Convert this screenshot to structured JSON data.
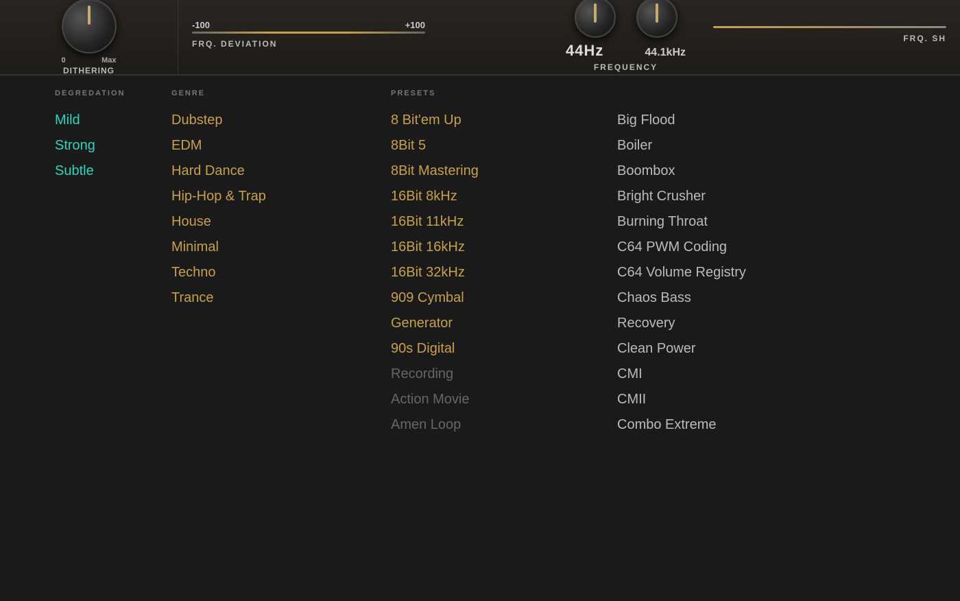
{
  "topPanel": {
    "dithering": {
      "knob": {
        "min": "0",
        "max": "Max",
        "label": "DITHERING"
      }
    },
    "frqDeviation": {
      "range_min": "-100",
      "range_max": "+100",
      "label": "FRQ. DEVIATION"
    },
    "frequency": {
      "value": "44Hz",
      "label": "FREQUENCY",
      "sub_value": "44.1kHz"
    },
    "frqShape": {
      "label": "FRQ. SH"
    }
  },
  "degradation": {
    "header": "DEGREDATION",
    "items": [
      {
        "label": "Mild",
        "style": "cyan"
      },
      {
        "label": "Strong",
        "style": "cyan"
      },
      {
        "label": "Subtle",
        "style": "cyan"
      }
    ]
  },
  "genre": {
    "header": "GENRE",
    "items": [
      {
        "label": "Dubstep",
        "style": "orange"
      },
      {
        "label": "EDM",
        "style": "orange"
      },
      {
        "label": "Hard Dance",
        "style": "orange"
      },
      {
        "label": "Hip-Hop & Trap",
        "style": "orange"
      },
      {
        "label": "House",
        "style": "orange"
      },
      {
        "label": "Minimal",
        "style": "orange"
      },
      {
        "label": "Techno",
        "style": "orange"
      },
      {
        "label": "Trance",
        "style": "orange"
      }
    ]
  },
  "presetsLeft": {
    "header": "PRESETS",
    "items": [
      {
        "label": "8 Bit'em Up",
        "style": "orange"
      },
      {
        "label": "8Bit 5",
        "style": "orange"
      },
      {
        "label": "8Bit Mastering",
        "style": "orange"
      },
      {
        "label": "16Bit 8kHz",
        "style": "orange"
      },
      {
        "label": "16Bit 11kHz",
        "style": "orange"
      },
      {
        "label": "16Bit 16kHz",
        "style": "orange"
      },
      {
        "label": "16Bit 32kHz",
        "style": "orange"
      },
      {
        "label": "909 Cymbal",
        "style": "orange"
      },
      {
        "label": "Generator",
        "style": "orange"
      },
      {
        "label": "90s Digital",
        "style": "orange"
      },
      {
        "label": "Recording",
        "style": "muted"
      },
      {
        "label": "Action Movie",
        "style": "muted"
      },
      {
        "label": "Amen Loop",
        "style": "muted"
      }
    ]
  },
  "presetsRight": {
    "items": [
      {
        "label": "Big Flood",
        "style": "light"
      },
      {
        "label": "Boiler",
        "style": "light"
      },
      {
        "label": "Boombox",
        "style": "light"
      },
      {
        "label": "Bright Crusher",
        "style": "light"
      },
      {
        "label": "Burning Throat",
        "style": "light"
      },
      {
        "label": "C64 PWM Coding",
        "style": "light"
      },
      {
        "label": "C64 Volume Registry",
        "style": "light"
      },
      {
        "label": "Chaos Bass",
        "style": "light"
      },
      {
        "label": "Recovery",
        "style": "light"
      },
      {
        "label": "Clean Power",
        "style": "light"
      },
      {
        "label": "CMI",
        "style": "light"
      },
      {
        "label": "CMII",
        "style": "light"
      },
      {
        "label": "Combo Extreme",
        "style": "light"
      }
    ]
  }
}
